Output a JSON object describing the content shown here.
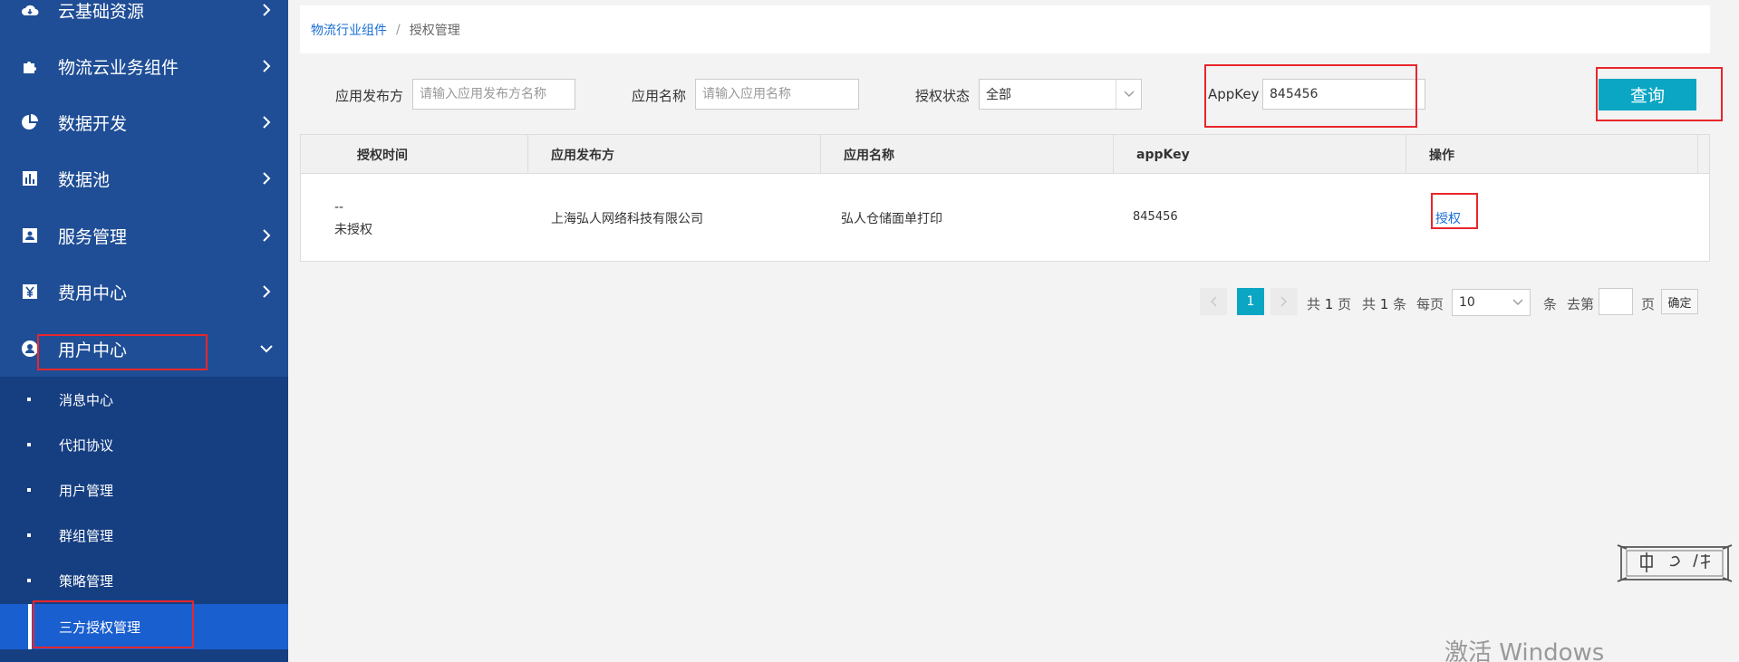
{
  "sidebar": {
    "menu": [
      {
        "label": "云基础资源",
        "icon": "cloud-icon"
      },
      {
        "label": "物流云业务组件",
        "icon": "puzzle-icon"
      },
      {
        "label": "数据开发",
        "icon": "pie-chart-icon"
      },
      {
        "label": "数据池",
        "icon": "bar-chart-icon"
      },
      {
        "label": "服务管理",
        "icon": "id-card-icon"
      },
      {
        "label": "费用中心",
        "icon": "yen-icon"
      },
      {
        "label": "用户中心",
        "icon": "user-icon"
      }
    ],
    "submenu": [
      {
        "label": "消息中心"
      },
      {
        "label": "代扣协议"
      },
      {
        "label": "用户管理"
      },
      {
        "label": "群组管理"
      },
      {
        "label": "策略管理"
      },
      {
        "label": "三方授权管理"
      }
    ]
  },
  "breadcrumb": {
    "parent": "物流行业组件",
    "separator": "/",
    "current": "授权管理"
  },
  "filters": {
    "publisher_label": "应用发布方",
    "publisher_placeholder": "请输入应用发布方名称",
    "app_name_label": "应用名称",
    "app_name_placeholder": "请输入应用名称",
    "auth_status_label": "授权状态",
    "auth_status_value": "全部",
    "appkey_label": "AppKey",
    "appkey_value": "845456",
    "query_button": "查询"
  },
  "table": {
    "headers": [
      "授权时间",
      "应用发布方",
      "应用名称",
      "appKey",
      "操作"
    ],
    "row": {
      "auth_time": "--",
      "auth_status": "未授权",
      "publisher": "上海弘人网络科技有限公司",
      "app_name": "弘人仓储面单打印",
      "appkey": "845456",
      "action": "授权"
    }
  },
  "pagination": {
    "current_page": "1",
    "total_pages_prefix": "共",
    "total_pages": "1",
    "total_pages_suffix": "页",
    "total_items_prefix": "共",
    "total_items": "1",
    "total_items_suffix": "条",
    "per_page_label": "每页",
    "per_page_value": "10",
    "per_page_suffix": "条",
    "goto_label": "去第",
    "goto_suffix": "页",
    "confirm_button": "确定"
  },
  "watermark": "激活 Windows",
  "colors": {
    "sidebar": "#1f4e96",
    "submenu": "#163f82",
    "active_submenu": "#1a5fcf",
    "accent": "#0aa6c4",
    "link": "#1a6fd6",
    "highlight": "#e8262c"
  }
}
